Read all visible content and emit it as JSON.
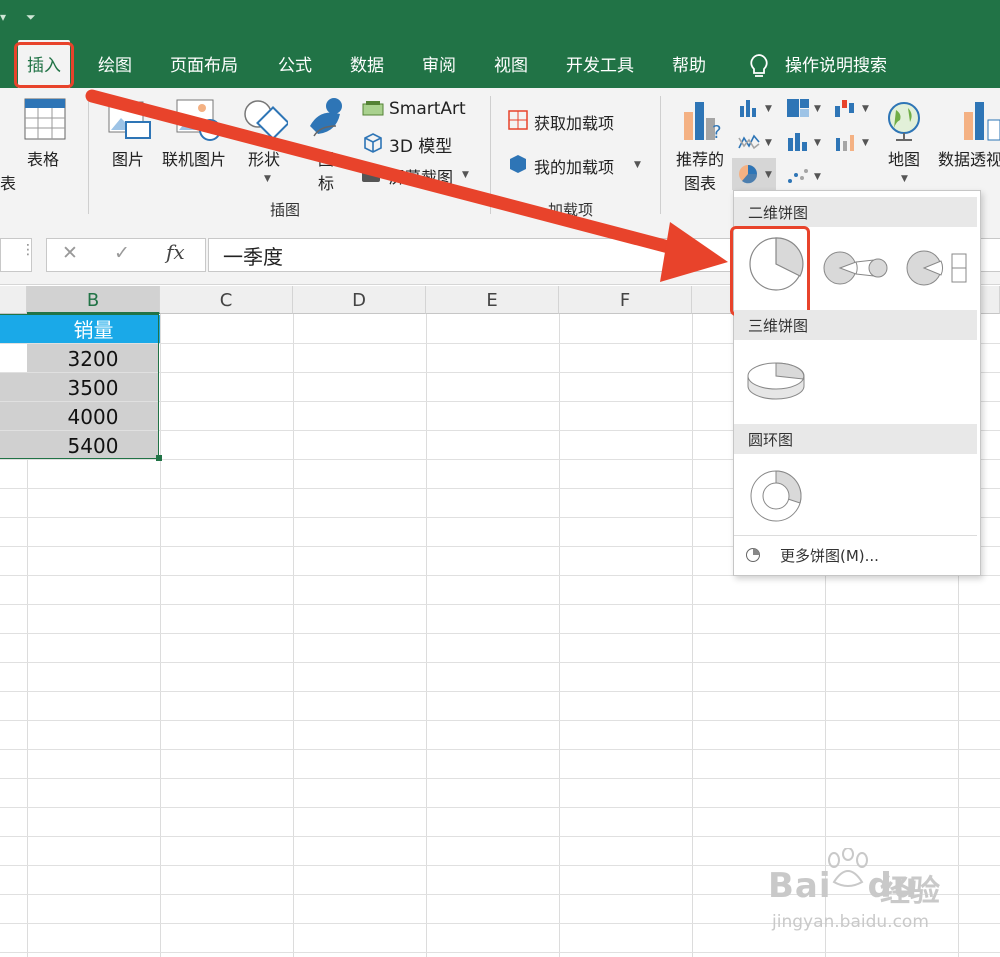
{
  "ribbon_tabs": [
    {
      "label": "插入",
      "active": true
    },
    {
      "label": "绘图"
    },
    {
      "label": "页面布局"
    },
    {
      "label": "公式"
    },
    {
      "label": "数据"
    },
    {
      "label": "审阅"
    },
    {
      "label": "视图"
    },
    {
      "label": "开发工具"
    },
    {
      "label": "帮助"
    }
  ],
  "tell_me": "操作说明搜索",
  "ribbon": {
    "partial_left": "表",
    "table": "表格",
    "pictures": "图片",
    "online_pictures": "联机图片",
    "shapes": "形状",
    "icons_line1": "图",
    "icons_line2": "标",
    "smartart": "SmartArt",
    "model3d": "3D 模型",
    "screenshot": "屏幕截图",
    "group_illustrations": "插图",
    "get_addins": "获取加载项",
    "my_addins": "我的加载项",
    "group_addins": "加载项",
    "recommended_line1": "推荐的",
    "recommended_line2": "图表",
    "maps": "地图",
    "pivot_partial": "数据透视"
  },
  "formula": {
    "cancel": "✕",
    "enter": "✓",
    "fx": "fx",
    "value": "一季度"
  },
  "columns": [
    "B",
    "C",
    "D",
    "E",
    "F"
  ],
  "sheet": {
    "header": "销量",
    "values": [
      "3200",
      "3500",
      "4000",
      "5400"
    ]
  },
  "dropdown": {
    "section_2d": "二维饼图",
    "section_3d": "三维饼图",
    "section_donut": "圆环图",
    "more": "更多饼图(M)..."
  },
  "watermark": {
    "brand": "Bai",
    "brand2": "du",
    "jingyan": "经验",
    "url": "jingyan.baidu.com"
  },
  "colors": {
    "excel_green": "#217346",
    "highlight_red": "#e8432b",
    "header_blue": "#1aa9e8",
    "selection_gray": "#d0d0d0"
  }
}
